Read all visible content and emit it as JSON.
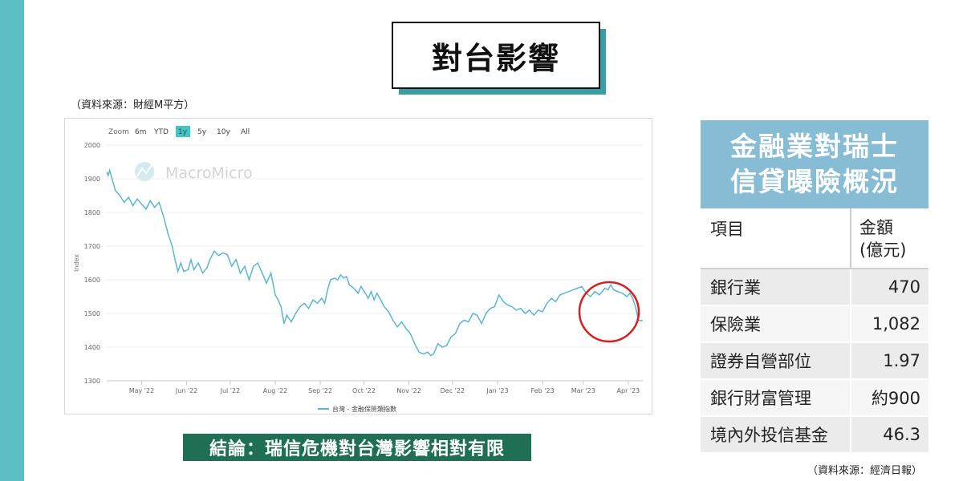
{
  "title": "對台影響",
  "source_left": "（資料來源：財經M平方）",
  "source_right": "（資料來源：經濟日報）",
  "conclusion": "結論：瑞信危機對台灣影響相對有限",
  "range_selector": {
    "zoom_label": "Zoom",
    "buttons": [
      "6m",
      "YTD",
      "1y",
      "5y",
      "10y",
      "All"
    ],
    "active": "1y"
  },
  "watermark": "MacroMicro",
  "colors": {
    "line": "#5bb6cf",
    "active_btn": "#3ec7c7",
    "circle": "#d62020",
    "table_head": "#87bcd5",
    "conclusion_bg": "#1f6f55",
    "side_bar": "#5cbfc4"
  },
  "chart_data": {
    "type": "line",
    "title": "",
    "xlabel": "",
    "ylabel": "Index",
    "ylim": [
      1300,
      2000
    ],
    "yticks": [
      1300,
      1400,
      1500,
      1600,
      1700,
      1800,
      1900,
      2000
    ],
    "xlim": [
      "2022-04-07",
      "2023-04-11"
    ],
    "x_ticks": [
      {
        "date": "2022-05-01",
        "label": "May '22"
      },
      {
        "date": "2022-06-01",
        "label": "Jun '22"
      },
      {
        "date": "2022-07-01",
        "label": "Jul '22"
      },
      {
        "date": "2022-08-01",
        "label": "Aug '22"
      },
      {
        "date": "2022-09-01",
        "label": "Sep '22"
      },
      {
        "date": "2022-10-01",
        "label": "Oct '22"
      },
      {
        "date": "2022-11-01",
        "label": "Nov '22"
      },
      {
        "date": "2022-12-01",
        "label": "Dec '22"
      },
      {
        "date": "2023-01-01",
        "label": "Jan '23"
      },
      {
        "date": "2023-02-01",
        "label": "Feb '23"
      },
      {
        "date": "2023-03-01",
        "label": "Mar '23"
      },
      {
        "date": "2023-04-01",
        "label": "Apr '23"
      }
    ],
    "grid": "horizontal",
    "legend_position": "bottom-center",
    "series": [
      {
        "name": "台灣 - 金融保險類指數",
        "points": [
          [
            "2022-04-07",
            1920
          ],
          [
            "2022-04-08",
            1910
          ],
          [
            "2022-04-09",
            1925
          ],
          [
            "2022-04-11",
            1895
          ],
          [
            "2022-04-13",
            1865
          ],
          [
            "2022-04-16",
            1850
          ],
          [
            "2022-04-19",
            1830
          ],
          [
            "2022-04-22",
            1845
          ],
          [
            "2022-04-25",
            1820
          ],
          [
            "2022-04-28",
            1840
          ],
          [
            "2022-05-01",
            1825
          ],
          [
            "2022-05-04",
            1810
          ],
          [
            "2022-05-07",
            1835
          ],
          [
            "2022-05-10",
            1815
          ],
          [
            "2022-05-13",
            1830
          ],
          [
            "2022-05-16",
            1790
          ],
          [
            "2022-05-19",
            1740
          ],
          [
            "2022-05-22",
            1700
          ],
          [
            "2022-05-24",
            1660
          ],
          [
            "2022-05-26",
            1625
          ],
          [
            "2022-05-28",
            1650
          ],
          [
            "2022-05-30",
            1625
          ],
          [
            "2022-06-02",
            1630
          ],
          [
            "2022-06-04",
            1660
          ],
          [
            "2022-06-06",
            1630
          ],
          [
            "2022-06-09",
            1650
          ],
          [
            "2022-06-12",
            1620
          ],
          [
            "2022-06-15",
            1635
          ],
          [
            "2022-06-17",
            1660
          ],
          [
            "2022-06-20",
            1685
          ],
          [
            "2022-06-23",
            1672
          ],
          [
            "2022-06-26",
            1680
          ],
          [
            "2022-06-29",
            1675
          ],
          [
            "2022-07-02",
            1640
          ],
          [
            "2022-07-05",
            1660
          ],
          [
            "2022-07-08",
            1620
          ],
          [
            "2022-07-11",
            1640
          ],
          [
            "2022-07-14",
            1600
          ],
          [
            "2022-07-17",
            1640
          ],
          [
            "2022-07-20",
            1650
          ],
          [
            "2022-07-23",
            1620
          ],
          [
            "2022-07-26",
            1590
          ],
          [
            "2022-07-29",
            1620
          ],
          [
            "2022-08-01",
            1555
          ],
          [
            "2022-08-03",
            1540
          ],
          [
            "2022-08-05",
            1520
          ],
          [
            "2022-08-07",
            1470
          ],
          [
            "2022-08-09",
            1495
          ],
          [
            "2022-08-12",
            1475
          ],
          [
            "2022-08-15",
            1500
          ],
          [
            "2022-08-18",
            1520
          ],
          [
            "2022-08-21",
            1530
          ],
          [
            "2022-08-24",
            1515
          ],
          [
            "2022-08-27",
            1540
          ],
          [
            "2022-08-30",
            1530
          ],
          [
            "2022-09-02",
            1545
          ],
          [
            "2022-09-04",
            1530
          ],
          [
            "2022-09-06",
            1570
          ],
          [
            "2022-09-08",
            1600
          ],
          [
            "2022-09-11",
            1605
          ],
          [
            "2022-09-13",
            1600
          ],
          [
            "2022-09-15",
            1615
          ],
          [
            "2022-09-17",
            1605
          ],
          [
            "2022-09-19",
            1610
          ],
          [
            "2022-09-21",
            1585
          ],
          [
            "2022-09-24",
            1575
          ],
          [
            "2022-09-27",
            1560
          ],
          [
            "2022-09-29",
            1580
          ],
          [
            "2022-10-02",
            1560
          ],
          [
            "2022-10-04",
            1545
          ],
          [
            "2022-10-06",
            1565
          ],
          [
            "2022-10-08",
            1540
          ],
          [
            "2022-10-10",
            1560
          ],
          [
            "2022-10-12",
            1545
          ],
          [
            "2022-10-15",
            1520
          ],
          [
            "2022-10-18",
            1505
          ],
          [
            "2022-10-21",
            1480
          ],
          [
            "2022-10-24",
            1460
          ],
          [
            "2022-10-27",
            1475
          ],
          [
            "2022-10-30",
            1455
          ],
          [
            "2022-11-02",
            1440
          ],
          [
            "2022-11-05",
            1410
          ],
          [
            "2022-11-08",
            1385
          ],
          [
            "2022-11-11",
            1380
          ],
          [
            "2022-11-14",
            1385
          ],
          [
            "2022-11-16",
            1375
          ],
          [
            "2022-11-18",
            1380
          ],
          [
            "2022-11-21",
            1410
          ],
          [
            "2022-11-24",
            1400
          ],
          [
            "2022-11-27",
            1405
          ],
          [
            "2022-11-30",
            1430
          ],
          [
            "2022-12-03",
            1440
          ],
          [
            "2022-12-06",
            1470
          ],
          [
            "2022-12-09",
            1480
          ],
          [
            "2022-12-12",
            1475
          ],
          [
            "2022-12-15",
            1500
          ],
          [
            "2022-12-18",
            1495
          ],
          [
            "2022-12-21",
            1470
          ],
          [
            "2022-12-24",
            1500
          ],
          [
            "2022-12-27",
            1515
          ],
          [
            "2022-12-30",
            1520
          ],
          [
            "2023-01-02",
            1555
          ],
          [
            "2023-01-05",
            1535
          ],
          [
            "2023-01-08",
            1525
          ],
          [
            "2023-01-11",
            1520
          ],
          [
            "2023-01-14",
            1510
          ],
          [
            "2023-01-17",
            1515
          ],
          [
            "2023-01-20",
            1500
          ],
          [
            "2023-01-23",
            1510
          ],
          [
            "2023-01-26",
            1495
          ],
          [
            "2023-01-29",
            1510
          ],
          [
            "2023-02-01",
            1505
          ],
          [
            "2023-02-04",
            1530
          ],
          [
            "2023-02-07",
            1545
          ],
          [
            "2023-02-10",
            1535
          ],
          [
            "2023-02-13",
            1555
          ],
          [
            "2023-02-16",
            1560
          ],
          [
            "2023-02-19",
            1565
          ],
          [
            "2023-02-22",
            1570
          ],
          [
            "2023-02-25",
            1575
          ],
          [
            "2023-02-28",
            1580
          ],
          [
            "2023-03-03",
            1560
          ],
          [
            "2023-03-06",
            1550
          ],
          [
            "2023-03-09",
            1565
          ],
          [
            "2023-03-12",
            1555
          ],
          [
            "2023-03-14",
            1565
          ],
          [
            "2023-03-16",
            1575
          ],
          [
            "2023-03-18",
            1570
          ],
          [
            "2023-03-20",
            1585
          ],
          [
            "2023-03-22",
            1570
          ],
          [
            "2023-03-25",
            1565
          ],
          [
            "2023-03-28",
            1560
          ],
          [
            "2023-03-31",
            1550
          ],
          [
            "2023-04-02",
            1560
          ],
          [
            "2023-04-04",
            1545
          ],
          [
            "2023-04-06",
            1520
          ],
          [
            "2023-04-08",
            1480
          ],
          [
            "2023-04-11",
            1478
          ]
        ]
      }
    ]
  },
  "table": {
    "title_lines": [
      "金融業對瑞士",
      "信貸曝險概況"
    ],
    "col_item": "項目",
    "col_amount_lines": [
      "金額",
      "(億元)"
    ],
    "rows": [
      {
        "item": "銀行業",
        "amount": "470"
      },
      {
        "item": "保險業",
        "amount": "1,082"
      },
      {
        "item": "證券自營部位",
        "amount": "1.97"
      },
      {
        "item": "銀行財富管理",
        "amount": "約900"
      },
      {
        "item": "境內外投信基金",
        "amount": "46.3"
      }
    ]
  }
}
